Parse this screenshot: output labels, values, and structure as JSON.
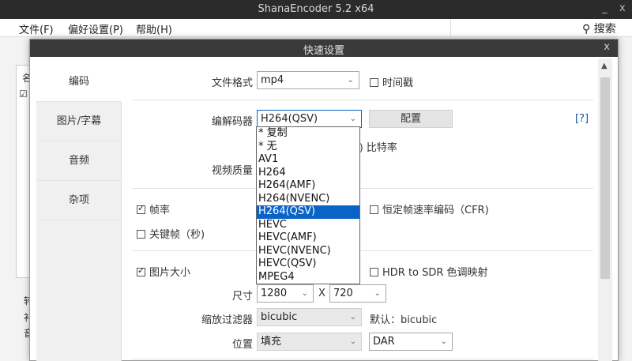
{
  "window": {
    "title": "ShanaEncoder 5.2 x64",
    "min": "_",
    "close": "x"
  },
  "menu": {
    "file": "文件(F)",
    "prefs": "偏好设置(P)",
    "help": "帮助(H)",
    "search": "搜索",
    "search_icon": "magnifier-icon"
  },
  "background": {
    "header_char": "名",
    "check_char": "☑",
    "side_chars": [
      "转",
      "补",
      "音"
    ]
  },
  "dialog": {
    "title": "快速设置",
    "close": "x",
    "tabs": [
      "编码",
      "图片/字幕",
      "音频",
      "杂项"
    ],
    "active_tab": 0
  },
  "form": {
    "format_label": "文件格式",
    "format_value": "mp4",
    "timestamp_label": "时间戳",
    "codec_label": "编解码器",
    "codec_value": "H264(QSV)",
    "config_button": "配置",
    "help_link": "[?]",
    "bitrate_label": "比特率",
    "quality_label": "视频质量",
    "framerate_label": "帧率",
    "framerate_checked": true,
    "cfr_label": "恒定帧速率编码（CFR)",
    "keyframe_label": "关键帧（秒)",
    "size_label_cb": "图片大小",
    "size_checked": true,
    "hdr_label": "HDR to SDR 色调映射",
    "dimension_label": "尺寸",
    "width_value": "1280",
    "x_sep": "X",
    "height_value": "720",
    "scale_filter_label": "缩放过滤器",
    "scale_filter_value": "bicubic",
    "default_text": "默认：bicubic",
    "position_label": "位置",
    "position_value": "填充",
    "aspect_value": "DAR"
  },
  "codec_options": [
    "* 复制",
    "* 无",
    "AV1",
    "H264",
    "H264(AMF)",
    "H264(NVENC)",
    "H264(QSV)",
    "HEVC",
    "HEVC(AMF)",
    "HEVC(NVENC)",
    "HEVC(QSV)",
    "MPEG4"
  ],
  "codec_selected_index": 6,
  "colors": {
    "accent": "#0a64c8",
    "titlebar": "#2b2b2b",
    "dialog_titlebar": "#3a3a3a"
  }
}
